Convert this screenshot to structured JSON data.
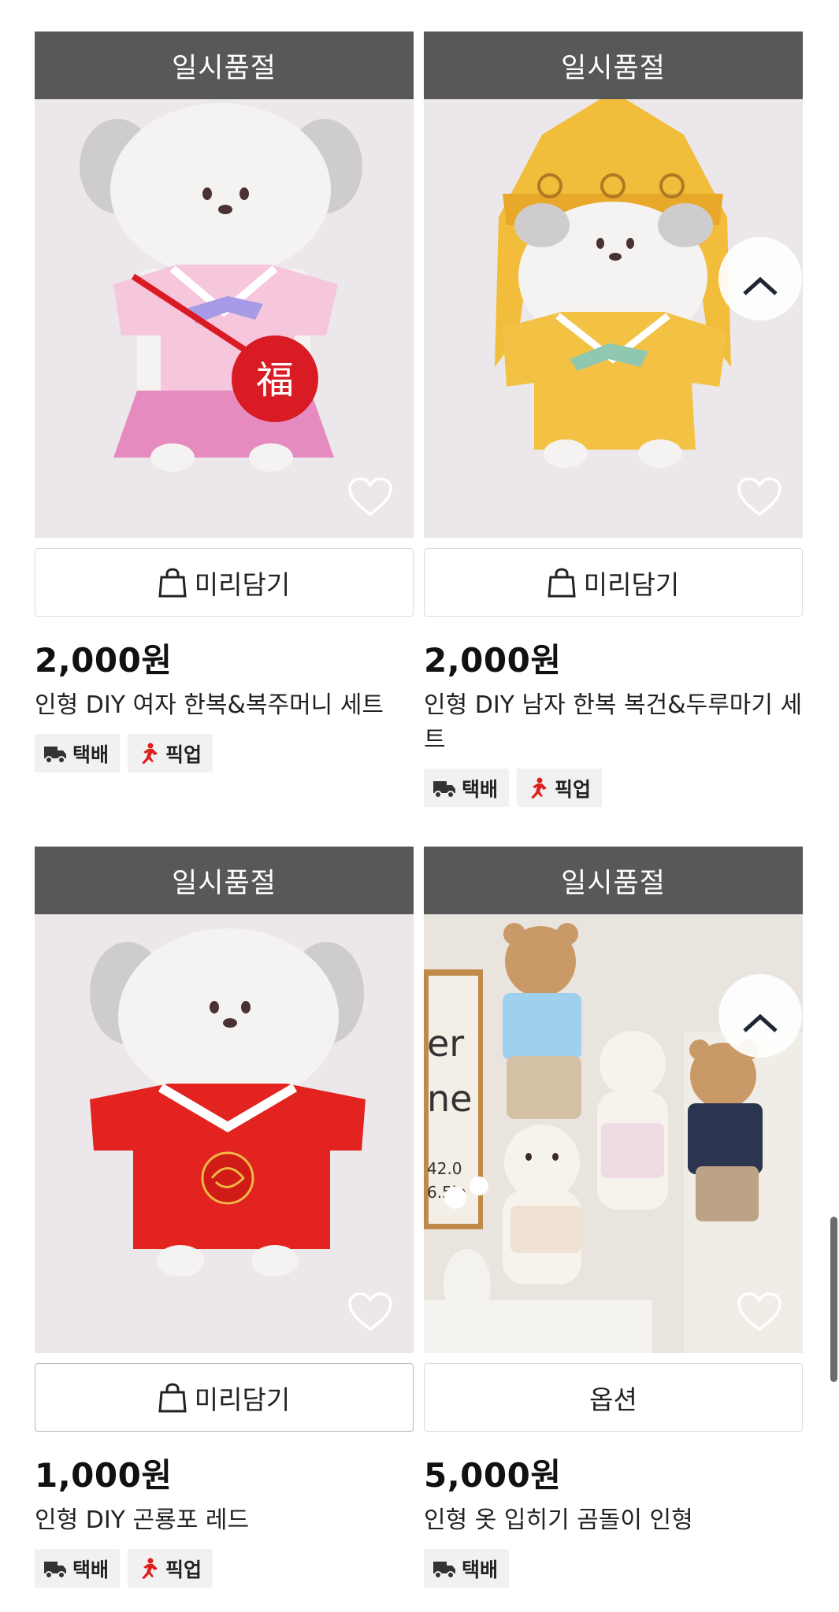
{
  "products": [
    {
      "sold_out_label": "일시품절",
      "action_label": "미리담기",
      "price": "2,000원",
      "name": "인형 DIY 여자 한복&복주머니 세트",
      "badges": [
        "택배",
        "픽업"
      ],
      "icon": "hanbok-pink-doll-photo"
    },
    {
      "sold_out_label": "일시품절",
      "action_label": "미리담기",
      "price": "2,000원",
      "name": "인형 DIY 남자 한복 복건&두루마기 세트",
      "badges": [
        "택배",
        "픽업"
      ],
      "icon": "hanbok-yellow-doll-photo"
    },
    {
      "sold_out_label": "일시품절",
      "action_label": "미리담기",
      "price": "1,000원",
      "name": "인형 DIY 곤룡포 레드",
      "badges": [
        "택배",
        "픽업"
      ],
      "icon": "hanbok-red-doll-photo"
    },
    {
      "sold_out_label": "일시품절",
      "action_label": "옵션",
      "price": "5,000원",
      "name": "인형 옷 입히기 곰돌이 인형",
      "badges": [
        "택배"
      ],
      "icon": "teddy-bears-photo"
    }
  ],
  "colors": {
    "sold_out_bar": "#595859",
    "photo_bg": "#ebe7ea",
    "pickup_icon": "#e0201c"
  }
}
